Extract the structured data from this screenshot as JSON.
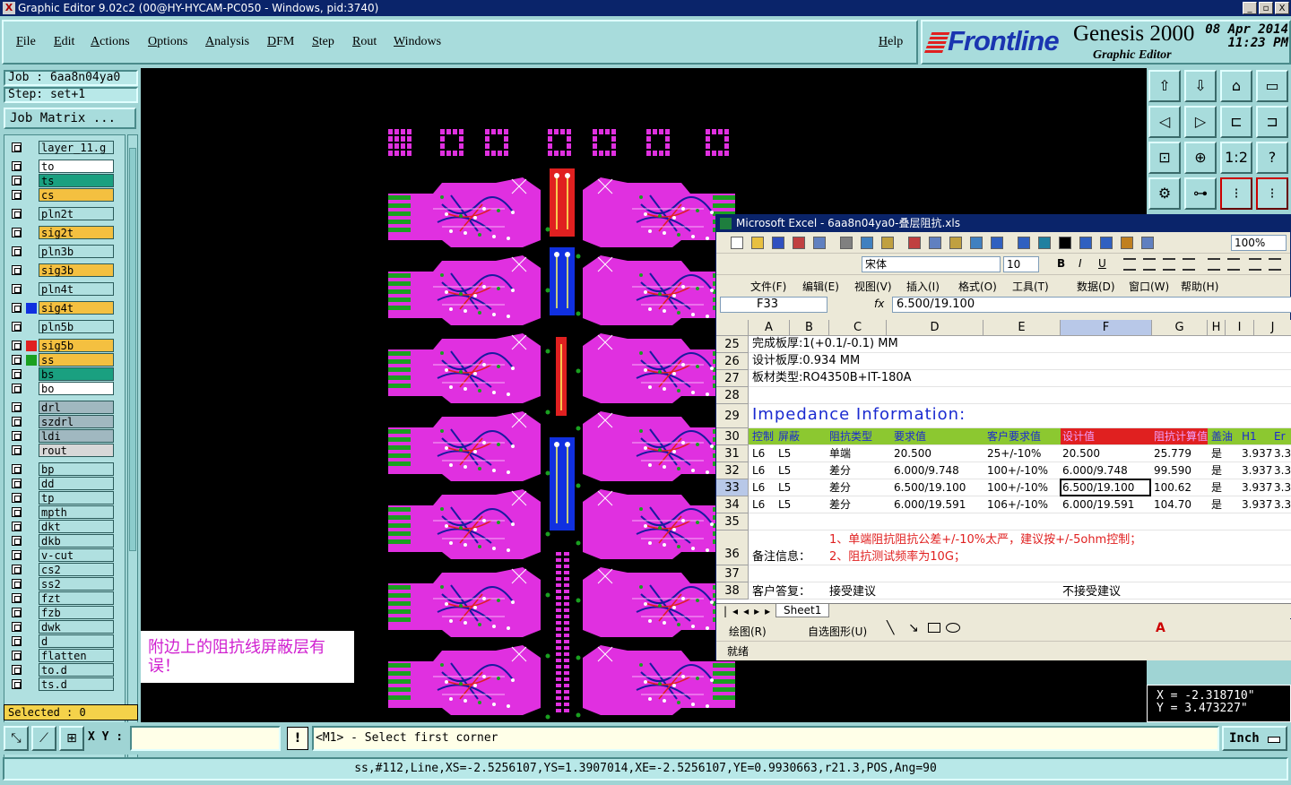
{
  "window": {
    "title": "Graphic Editor 9.02c2 (00@HY-HYCAM-PC050 - Windows, pid:3740)",
    "controls": [
      "_",
      "▫",
      "X"
    ]
  },
  "menu": [
    "File",
    "Edit",
    "Actions",
    "Options",
    "Analysis",
    "DFM",
    "Step",
    "Rout",
    "Windows"
  ],
  "help_label": "Help",
  "brand": {
    "logo": "Frontline",
    "product": "Genesis 2000",
    "date": "08 Apr 2014",
    "time": "11:23 PM",
    "subtitle": "Graphic Editor"
  },
  "job": {
    "job_label": "Job  :  6aa8n04ya0",
    "step_label": "Step:  set+1",
    "matrix_button": "Job Matrix ..."
  },
  "layers": [
    {
      "name": "layer_11.g",
      "bg": "#b0e0e0",
      "swatch": ""
    },
    {
      "name": "to",
      "bg": "#ffffff",
      "swatch": ""
    },
    {
      "name": "ts",
      "bg": "#1aa080",
      "swatch": ""
    },
    {
      "name": "cs",
      "bg": "#f4c040",
      "swatch": ""
    },
    {
      "name": "pln2t",
      "bg": "#b0e0e0",
      "swatch": ""
    },
    {
      "name": "sig2t",
      "bg": "#f4c040",
      "swatch": ""
    },
    {
      "name": "pln3b",
      "bg": "#b0e0e0",
      "swatch": ""
    },
    {
      "name": "sig3b",
      "bg": "#f4c040",
      "swatch": ""
    },
    {
      "name": "pln4t",
      "bg": "#b0e0e0",
      "swatch": ""
    },
    {
      "name": "sig4t",
      "bg": "#f4c040",
      "swatch": "#1030e0"
    },
    {
      "name": "pln5b",
      "bg": "#b0e0e0",
      "swatch": ""
    },
    {
      "name": "sig5b",
      "bg": "#f4c040",
      "swatch": "#e02020"
    },
    {
      "name": "ss",
      "bg": "#f4c040",
      "swatch": "#1aa020"
    },
    {
      "name": "bs",
      "bg": "#1aa080",
      "swatch": ""
    },
    {
      "name": "bo",
      "bg": "#ffffff",
      "swatch": ""
    },
    {
      "name": "drl",
      "bg": "#a0b8c0",
      "swatch": ""
    },
    {
      "name": "szdrl",
      "bg": "#a0b8c0",
      "swatch": ""
    },
    {
      "name": "ldi",
      "bg": "#a0b8c0",
      "swatch": ""
    },
    {
      "name": "rout",
      "bg": "#d8d8d8",
      "swatch": ""
    },
    {
      "name": "bp",
      "bg": "#b0e0e0",
      "swatch": ""
    },
    {
      "name": "dd",
      "bg": "#b0e0e0",
      "swatch": ""
    },
    {
      "name": "tp",
      "bg": "#b0e0e0",
      "swatch": ""
    },
    {
      "name": "mpth",
      "bg": "#b0e0e0",
      "swatch": ""
    },
    {
      "name": "dkt",
      "bg": "#b0e0e0",
      "swatch": ""
    },
    {
      "name": "dkb",
      "bg": "#b0e0e0",
      "swatch": ""
    },
    {
      "name": "v-cut",
      "bg": "#b0e0e0",
      "swatch": ""
    },
    {
      "name": "cs2",
      "bg": "#b0e0e0",
      "swatch": ""
    },
    {
      "name": "ss2",
      "bg": "#b0e0e0",
      "swatch": ""
    },
    {
      "name": "fzt",
      "bg": "#b0e0e0",
      "swatch": ""
    },
    {
      "name": "fzb",
      "bg": "#b0e0e0",
      "swatch": ""
    },
    {
      "name": "dwk",
      "bg": "#b0e0e0",
      "swatch": ""
    },
    {
      "name": "d",
      "bg": "#b0e0e0",
      "swatch": ""
    },
    {
      "name": "flatten",
      "bg": "#b0e0e0",
      "swatch": ""
    },
    {
      "name": "to.d",
      "bg": "#b0e0e0",
      "swatch": ""
    },
    {
      "name": "ts.d",
      "bg": "#b0e0e0",
      "swatch": ""
    }
  ],
  "selected_label": "Selected : 0",
  "note": "附边上的阻抗线屏蔽层有误！",
  "tools": [
    "⇧",
    "⇩",
    "⌂",
    "▭",
    "◁",
    "▷",
    "⊏",
    "⊐",
    "⊡",
    "⊕",
    "1:2",
    "?",
    "⚙",
    "⊶",
    "⁝",
    "⁝"
  ],
  "excel": {
    "title": "Microsoft Excel - 6aa8n04ya0-叠层阻抗.xls",
    "zoom": "100%",
    "font": "宋体",
    "size": "10",
    "menu": [
      "文件(F)",
      "编辑(E)",
      "视图(V)",
      "插入(I)",
      "格式(O)",
      "工具(T)",
      "数据(D)",
      "窗口(W)",
      "帮助(H)"
    ],
    "name_box": "F33",
    "fx": "fx",
    "formula": "6.500/19.100",
    "columns": [
      "A",
      "B",
      "C",
      "D",
      "E",
      "F",
      "G",
      "H",
      "I",
      "J"
    ],
    "rows": [
      "25",
      "26",
      "27",
      "28",
      "29",
      "30",
      "31",
      "32",
      "33",
      "34",
      "35",
      "36",
      "37",
      "38"
    ],
    "r25": "完成板厚:1(+0.1/-0.1) MM",
    "r26": "设计板厚:0.934 MM",
    "r27": "板材类型:RO4350B+IT-180A",
    "r29": "Impedance Information:",
    "header": [
      "控制",
      "屏蔽",
      "阻抗类型",
      "要求值",
      "客户要求值",
      "设计值",
      "阻抗计算值",
      "盖油",
      "H1",
      "Er"
    ],
    "data": [
      [
        "L6",
        "L5",
        "单端",
        "20.500",
        "25+/-10%",
        "20.500",
        "25.779",
        "是",
        "3.937",
        "3.3"
      ],
      [
        "L6",
        "L5",
        "差分",
        "6.000/9.748",
        "100+/-10%",
        "6.000/9.748",
        "99.590",
        "是",
        "3.937",
        "3.3"
      ],
      [
        "L6",
        "L5",
        "差分",
        "6.500/19.100",
        "100+/-10%",
        "6.500/19.100",
        "100.62",
        "是",
        "3.937",
        "3.3"
      ],
      [
        "L6",
        "L5",
        "差分",
        "6.000/19.591",
        "106+/-10%",
        "6.000/19.591",
        "104.70",
        "是",
        "3.937",
        "3.3"
      ]
    ],
    "remark1": "1、单端阻抗阻抗公差+/-10%太严，建议按+/-5ohm控制；",
    "remark_label": "备注信息：",
    "remark2": "2、阻抗测试频率为10G；",
    "reply_label": "客户答复：",
    "accept": "接受建议",
    "reject": "不接受建议",
    "sheet_tab": "Sheet1",
    "draw_label": "绘图(R)",
    "autoshape_label": "自选图形(U)",
    "status": "就绪"
  },
  "coords": {
    "x": "X = -2.318710\"",
    "y": "Y =  3.473227\""
  },
  "xy_label": "X Y :",
  "bang": "!",
  "prompt": "<M1> - Select first corner",
  "units": "Inch",
  "info": "ss,#112,Line,XS=-2.5256107,YS=1.3907014,XE=-2.5256107,YE=0.9930663,r21.3,POS,Ang=90"
}
